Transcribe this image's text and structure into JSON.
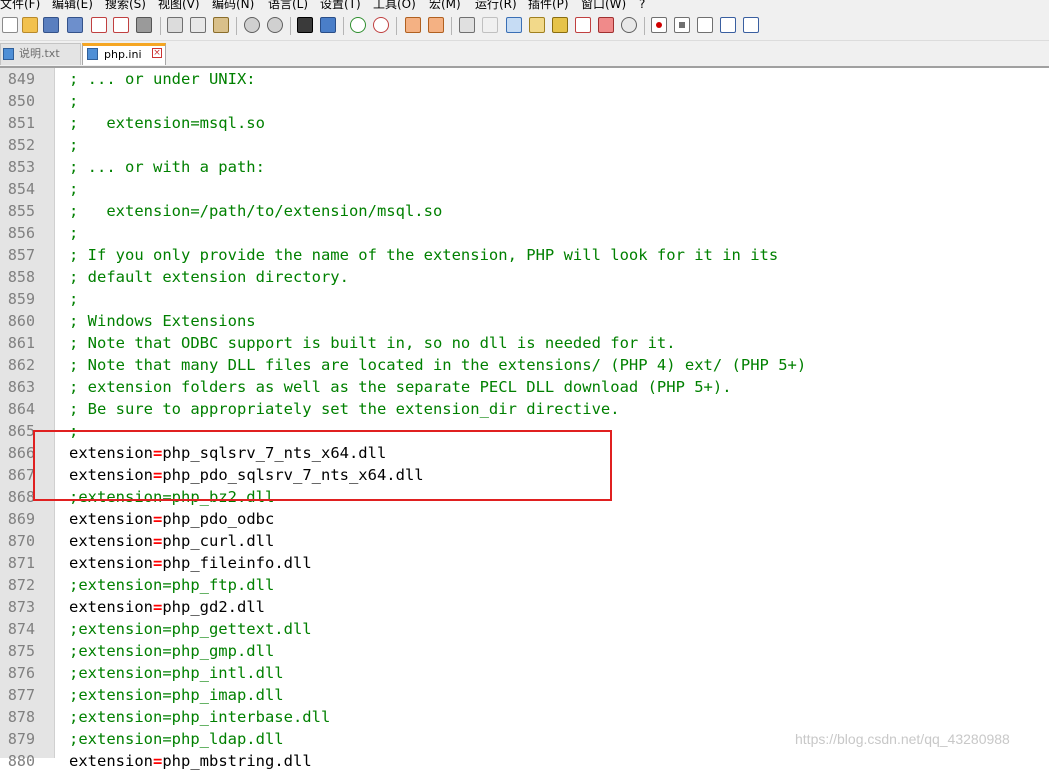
{
  "menu": [
    "文件(F)",
    "编辑(E)",
    "搜索(S)",
    "视图(V)",
    "编码(N)",
    "语言(L)",
    "设置(T)",
    "工具(O)",
    "宏(M)",
    "运行(R)",
    "插件(P)",
    "窗口(W)",
    "?"
  ],
  "tabs": [
    {
      "label": "说明.txt",
      "active": false
    },
    {
      "label": "php.ini",
      "active": true
    }
  ],
  "lines": [
    {
      "n": "849",
      "comment": "; ... or under UNIX:"
    },
    {
      "n": "850",
      "comment": ";"
    },
    {
      "n": "851",
      "comment": ";   extension=msql.so"
    },
    {
      "n": "852",
      "comment": ";"
    },
    {
      "n": "853",
      "comment": "; ... or with a path:"
    },
    {
      "n": "854",
      "comment": ";"
    },
    {
      "n": "855",
      "comment": ";   extension=/path/to/extension/msql.so"
    },
    {
      "n": "856",
      "comment": ";"
    },
    {
      "n": "857",
      "comment": "; If you only provide the name of the extension, PHP will look for it in its"
    },
    {
      "n": "858",
      "comment": "; default extension directory."
    },
    {
      "n": "859",
      "comment": ";"
    },
    {
      "n": "860",
      "comment": "; Windows Extensions"
    },
    {
      "n": "861",
      "comment": "; Note that ODBC support is built in, so no dll is needed for it."
    },
    {
      "n": "862",
      "comment": "; Note that many DLL files are located in the extensions/ (PHP 4) ext/ (PHP 5+)"
    },
    {
      "n": "863",
      "comment": "; extension folders as well as the separate PECL DLL download (PHP 5+)."
    },
    {
      "n": "864",
      "comment": "; Be sure to appropriately set the extension_dir directive."
    },
    {
      "n": "865",
      "comment": ";"
    },
    {
      "n": "866",
      "key": "extension",
      "eq": "=",
      "value": "php_sqlsrv_7_nts_x64.dll"
    },
    {
      "n": "867",
      "key": "extension",
      "eq": "=",
      "value": "php_pdo_sqlsrv_7_nts_x64.dll"
    },
    {
      "n": "868",
      "comment": ";extension=php_bz2.dll"
    },
    {
      "n": "869",
      "key": "extension",
      "eq": "=",
      "value": "php_pdo_odbc"
    },
    {
      "n": "870",
      "key": "extension",
      "eq": "=",
      "value": "php_curl.dll"
    },
    {
      "n": "871",
      "key": "extension",
      "eq": "=",
      "value": "php_fileinfo.dll"
    },
    {
      "n": "872",
      "comment": ";extension=php_ftp.dll"
    },
    {
      "n": "873",
      "key": "extension",
      "eq": "=",
      "value": "php_gd2.dll"
    },
    {
      "n": "874",
      "comment": ";extension=php_gettext.dll"
    },
    {
      "n": "875",
      "comment": ";extension=php_gmp.dll"
    },
    {
      "n": "876",
      "comment": ";extension=php_intl.dll"
    },
    {
      "n": "877",
      "comment": ";extension=php_imap.dll"
    },
    {
      "n": "878",
      "comment": ";extension=php_interbase.dll"
    },
    {
      "n": "879",
      "comment": ";extension=php_ldap.dll"
    },
    {
      "n": "880",
      "key": "extension",
      "eq": "=",
      "value": "php_mbstring.dll"
    }
  ],
  "watermark": "https://blog.csdn.net/qq_43280988",
  "colors": {
    "comment": "#008000",
    "operator": "#ff0000",
    "highlight_box": "#e02020",
    "active_tab_accent": "#f5a623"
  }
}
